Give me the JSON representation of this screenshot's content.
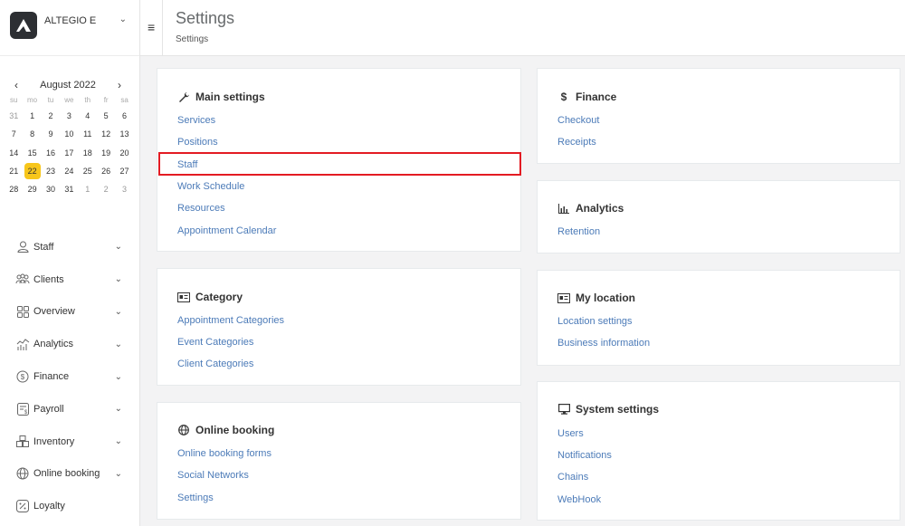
{
  "brand": {
    "name": "ALTEGIO E"
  },
  "calendar": {
    "month": "August 2022",
    "prev": "‹",
    "next": "›",
    "weekdays": [
      "su",
      "mo",
      "tu",
      "we",
      "th",
      "fr",
      "sa"
    ],
    "days": [
      "31",
      "1",
      "2",
      "3",
      "4",
      "5",
      "6",
      "7",
      "8",
      "9",
      "10",
      "11",
      "12",
      "13",
      "14",
      "15",
      "16",
      "17",
      "18",
      "19",
      "20",
      "21",
      "22",
      "23",
      "24",
      "25",
      "26",
      "27",
      "28",
      "29",
      "30",
      "31",
      "1",
      "2",
      "3"
    ],
    "today": "22"
  },
  "menu": {
    "items": [
      {
        "label": "Staff",
        "icon": "person-icon"
      },
      {
        "label": "Clients",
        "icon": "clients-icon"
      },
      {
        "label": "Overview",
        "icon": "grid-icon"
      },
      {
        "label": "Analytics",
        "icon": "analytics-icon"
      },
      {
        "label": "Finance",
        "icon": "dollar-circle-icon"
      },
      {
        "label": "Payroll",
        "icon": "payroll-icon"
      },
      {
        "label": "Inventory",
        "icon": "inventory-icon"
      },
      {
        "label": "Online booking",
        "icon": "globe-icon"
      },
      {
        "label": "Loyalty",
        "icon": "loyalty-icon"
      }
    ]
  },
  "header": {
    "title": "Settings",
    "breadcrumb": "Settings"
  },
  "cards": {
    "main": {
      "title": "Main settings",
      "links": [
        "Services",
        "Positions",
        "Staff",
        "Work Schedule",
        "Resources",
        "Appointment Calendar"
      ]
    },
    "category": {
      "title": "Category",
      "links": [
        "Appointment Categories",
        "Event Categories",
        "Client Categories"
      ]
    },
    "booking": {
      "title": "Online booking",
      "links": [
        "Online booking forms",
        "Social Networks",
        "Settings"
      ]
    },
    "finance": {
      "title": "Finance",
      "links": [
        "Checkout",
        "Receipts"
      ]
    },
    "analytics": {
      "title": "Analytics",
      "links": [
        "Retention"
      ]
    },
    "location": {
      "title": "My location",
      "links": [
        "Location settings",
        "Business information"
      ]
    },
    "system": {
      "title": "System settings",
      "links": [
        "Users",
        "Notifications",
        "Chains",
        "WebHook"
      ]
    }
  },
  "colors": {
    "link": "#4c7bb8",
    "today": "#f7c61b",
    "highlight": "#e31b23"
  }
}
